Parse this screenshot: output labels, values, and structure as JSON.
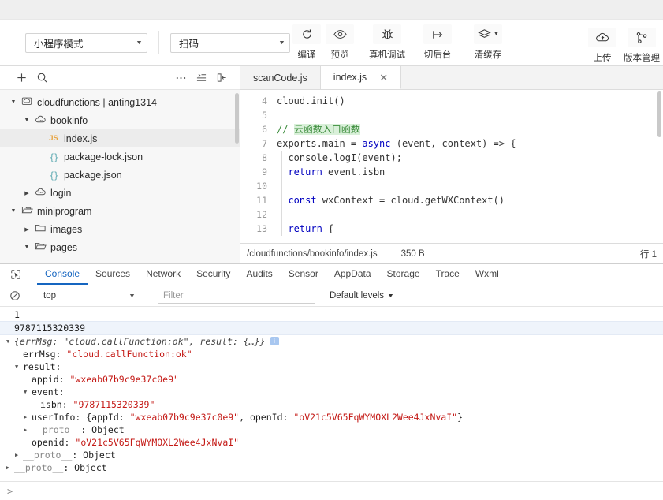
{
  "toolbar": {
    "mode_select": {
      "value": "小程序模式",
      "icon": "chevron-down-icon"
    },
    "scan_select": {
      "value": "扫码",
      "icon": "chevron-down-icon"
    },
    "buttons": [
      {
        "label": "编译",
        "icon": "refresh-icon"
      },
      {
        "label": "预览",
        "icon": "eye-icon"
      },
      {
        "label": "真机调试",
        "icon": "bug-icon"
      },
      {
        "label": "切后台",
        "icon": "switch-background-icon"
      },
      {
        "label": "清缓存",
        "icon": "layers-icon",
        "has_caret": true
      }
    ],
    "right_buttons": [
      {
        "label": "上传",
        "icon": "cloud-upload-icon"
      },
      {
        "label": "版本管理",
        "icon": "branch-icon"
      }
    ]
  },
  "sidebar": {
    "header_icons": [
      "plus-icon",
      "search-icon",
      "more-icon",
      "collapse-all-icon",
      "panel-toggle-icon"
    ],
    "tree": [
      {
        "label": "cloudfunctions | anting1314",
        "depth": 0,
        "twisty": "down",
        "icon": "cloud-root-icon",
        "selected": false
      },
      {
        "label": "bookinfo",
        "depth": 1,
        "twisty": "down",
        "icon": "cloud-function-icon",
        "selected": false
      },
      {
        "label": "index.js",
        "depth": 2,
        "twisty": "none",
        "icon": "js-file-icon",
        "selected": true
      },
      {
        "label": "package-lock.json",
        "depth": 2,
        "twisty": "none",
        "icon": "json-file-icon",
        "selected": false
      },
      {
        "label": "package.json",
        "depth": 2,
        "twisty": "none",
        "icon": "json-file-icon",
        "selected": false
      },
      {
        "label": "login",
        "depth": 1,
        "twisty": "right",
        "icon": "cloud-function-icon",
        "selected": false
      },
      {
        "label": "miniprogram",
        "depth": 0,
        "twisty": "down",
        "icon": "folder-open-icon",
        "selected": false
      },
      {
        "label": "images",
        "depth": 1,
        "twisty": "right",
        "icon": "folder-icon",
        "selected": false
      },
      {
        "label": "pages",
        "depth": 1,
        "twisty": "down",
        "icon": "folder-open-icon",
        "selected": false
      }
    ]
  },
  "editor": {
    "tabs": [
      {
        "label": "scanCode.js",
        "active": false,
        "closable": false
      },
      {
        "label": "index.js",
        "active": true,
        "closable": true
      }
    ],
    "close_glyph": "✕",
    "lines": [
      {
        "no": "4",
        "segments": [
          {
            "t": "cloud.init()",
            "c": "plain"
          }
        ],
        "guide": false
      },
      {
        "no": "5",
        "segments": [],
        "guide": false
      },
      {
        "no": "6",
        "segments": [
          {
            "t": "// ",
            "c": "comment"
          },
          {
            "t": "云函数入口函数",
            "c": "comment-hl"
          }
        ],
        "guide": false
      },
      {
        "no": "7",
        "segments": [
          {
            "t": "exports.main = ",
            "c": "plain"
          },
          {
            "t": "async",
            "c": "keyword"
          },
          {
            "t": " (event, context) => {",
            "c": "plain"
          }
        ],
        "guide": false
      },
      {
        "no": "8",
        "segments": [
          {
            "t": "  console.logI(event);",
            "c": "plain"
          }
        ],
        "guide": true
      },
      {
        "no": "9",
        "segments": [
          {
            "t": "  ",
            "c": "plain"
          },
          {
            "t": "return",
            "c": "keyword"
          },
          {
            "t": " event.isbn",
            "c": "plain"
          }
        ],
        "guide": true
      },
      {
        "no": "10",
        "segments": [],
        "guide": true
      },
      {
        "no": "11",
        "segments": [
          {
            "t": "  ",
            "c": "plain"
          },
          {
            "t": "const",
            "c": "keyword"
          },
          {
            "t": " wxContext = cloud.getWXContext()",
            "c": "plain"
          }
        ],
        "guide": true
      },
      {
        "no": "12",
        "segments": [],
        "guide": true
      },
      {
        "no": "13",
        "segments": [
          {
            "t": "  ",
            "c": "plain"
          },
          {
            "t": "return",
            "c": "keyword"
          },
          {
            "t": " {",
            "c": "plain"
          }
        ],
        "guide": true
      }
    ],
    "status": {
      "path": "/cloudfunctions/bookinfo/index.js",
      "size": "350 B",
      "right": "行 1"
    }
  },
  "devtools": {
    "inspect_icon": "cursor-inspect-icon",
    "tabs": [
      {
        "label": "Console",
        "active": true
      },
      {
        "label": "Sources",
        "active": false
      },
      {
        "label": "Network",
        "active": false
      },
      {
        "label": "Security",
        "active": false
      },
      {
        "label": "Audits",
        "active": false
      },
      {
        "label": "Sensor",
        "active": false
      },
      {
        "label": "AppData",
        "active": false
      },
      {
        "label": "Storage",
        "active": false
      },
      {
        "label": "Trace",
        "active": false
      },
      {
        "label": "Wxml",
        "active": false
      }
    ],
    "filterbar": {
      "clear_icon": "clear-console-icon",
      "context": "top",
      "filter_placeholder": "Filter",
      "filter_value": "",
      "levels": "Default levels"
    },
    "console_rows": [
      {
        "indent": 0,
        "twisty": "none",
        "highlight": false,
        "segments": [
          {
            "t": "1",
            "c": "plain"
          }
        ]
      },
      {
        "indent": 0,
        "twisty": "none",
        "highlight": true,
        "segments": [
          {
            "t": "9787115320339",
            "c": "plain"
          }
        ]
      },
      {
        "indent": 0,
        "twisty": "down",
        "highlight": false,
        "badge": "i",
        "segments": [
          {
            "t": "{errMsg: \"cloud.callFunction:ok\", result: {…}}",
            "c": "italic"
          }
        ]
      },
      {
        "indent": 1,
        "twisty": "none",
        "highlight": false,
        "segments": [
          {
            "t": "errMsg: ",
            "c": "plain"
          },
          {
            "t": "\"cloud.callFunction:ok\"",
            "c": "string"
          }
        ]
      },
      {
        "indent": 1,
        "twisty": "down",
        "highlight": false,
        "segments": [
          {
            "t": "result:",
            "c": "plain"
          }
        ]
      },
      {
        "indent": 2,
        "twisty": "none",
        "highlight": false,
        "segments": [
          {
            "t": "appid: ",
            "c": "plain"
          },
          {
            "t": "\"wxeab07b9c9e37c0e9\"",
            "c": "string"
          }
        ]
      },
      {
        "indent": 2,
        "twisty": "down",
        "highlight": false,
        "segments": [
          {
            "t": "event:",
            "c": "plain"
          }
        ]
      },
      {
        "indent": 3,
        "twisty": "none",
        "highlight": false,
        "segments": [
          {
            "t": "isbn: ",
            "c": "plain"
          },
          {
            "t": "\"9787115320339\"",
            "c": "string"
          }
        ]
      },
      {
        "indent": 2,
        "twisty": "right",
        "highlight": false,
        "segments": [
          {
            "t": "userInfo: {appId: ",
            "c": "plain"
          },
          {
            "t": "\"wxeab07b9c9e37c0e9\"",
            "c": "string"
          },
          {
            "t": ", openId: ",
            "c": "plain"
          },
          {
            "t": "\"oV21c5V65FqWYMOXL2Wee4JxNvaI\"",
            "c": "string"
          },
          {
            "t": "}",
            "c": "plain"
          }
        ]
      },
      {
        "indent": 2,
        "twisty": "right",
        "highlight": false,
        "segments": [
          {
            "t": "__proto__",
            "c": "gray"
          },
          {
            "t": ": Object",
            "c": "plain"
          }
        ]
      },
      {
        "indent": 2,
        "twisty": "none",
        "highlight": false,
        "segments": [
          {
            "t": "openid: ",
            "c": "plain"
          },
          {
            "t": "\"oV21c5V65FqWYMOXL2Wee4JxNvaI\"",
            "c": "string"
          }
        ]
      },
      {
        "indent": 1,
        "twisty": "right",
        "highlight": false,
        "segments": [
          {
            "t": "__proto__",
            "c": "gray"
          },
          {
            "t": ": Object",
            "c": "plain"
          }
        ]
      },
      {
        "indent": 0,
        "twisty": "right",
        "highlight": false,
        "segments": [
          {
            "t": "__proto__",
            "c": "gray"
          },
          {
            "t": ": Object",
            "c": "plain"
          }
        ]
      }
    ],
    "prompt": ">"
  },
  "colors": {
    "accent": "#1565c0",
    "selection": "#ececec",
    "console_highlight": "#eff4fb",
    "string": "#c41a16",
    "keyword": "#0000c0",
    "comment": "#3c8c3c",
    "js_badge": "#e8a33d",
    "json_badge": "#5aa8b0"
  }
}
